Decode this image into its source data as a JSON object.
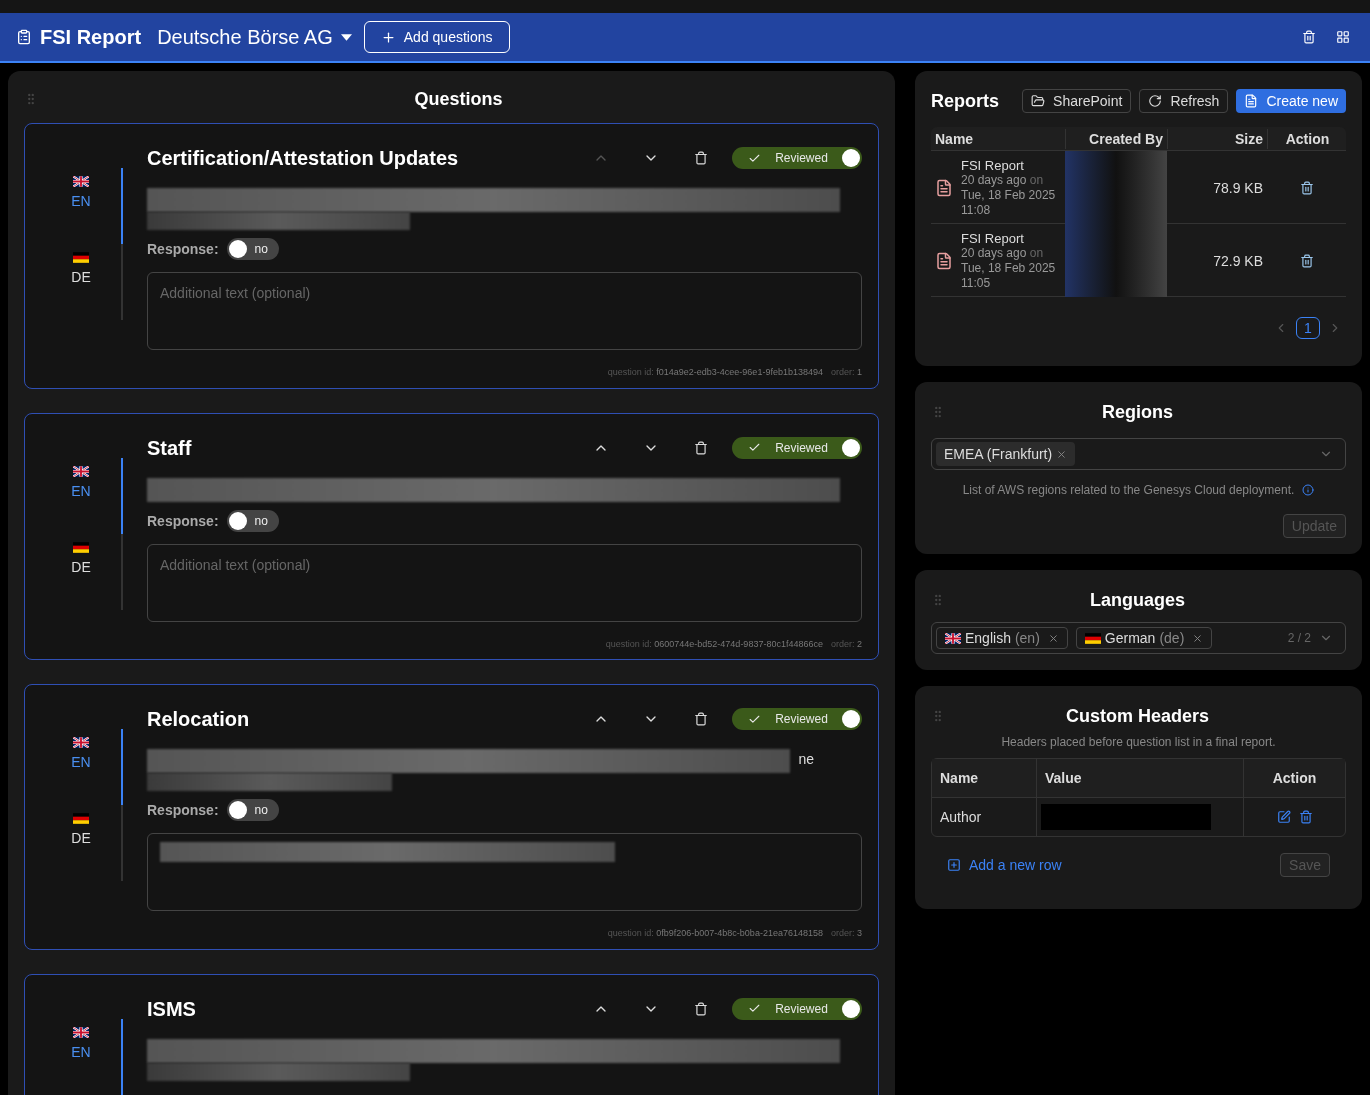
{
  "header": {
    "title": "FSI Report",
    "company": "Deutsche Börse AG",
    "add_button": "Add questions"
  },
  "questions_panel": {
    "title": "Questions",
    "items": [
      {
        "title": "Certification/Attestation Updates",
        "up_disabled": true,
        "languages": [
          {
            "code": "EN",
            "selected": true
          },
          {
            "code": "DE",
            "selected": false
          }
        ],
        "reviewed": {
          "label": "Reviewed",
          "on": true
        },
        "response": {
          "label": "Response:",
          "value": "no",
          "on": false
        },
        "textarea": {
          "placeholder": "Additional text (optional)",
          "redacted": false
        },
        "footer": {
          "id_label": "question id:",
          "id": "f014a9e2-edb3-4cee-96e1-9feb1b138494",
          "order_label": "order:",
          "order": "1"
        }
      },
      {
        "title": "Staff",
        "up_disabled": false,
        "languages": [
          {
            "code": "EN",
            "selected": true
          },
          {
            "code": "DE",
            "selected": false
          }
        ],
        "reviewed": {
          "label": "Reviewed",
          "on": true
        },
        "response": {
          "label": "Response:",
          "value": "no",
          "on": false
        },
        "textarea": {
          "placeholder": "Additional text (optional)",
          "redacted": false
        },
        "footer": {
          "id_label": "question id:",
          "id": "0600744e-bd52-474d-9837-80c1f44866ce",
          "order_label": "order:",
          "order": "2"
        }
      },
      {
        "title": "Relocation",
        "up_disabled": false,
        "fragment": "ne",
        "languages": [
          {
            "code": "EN",
            "selected": true
          },
          {
            "code": "DE",
            "selected": false
          }
        ],
        "reviewed": {
          "label": "Reviewed",
          "on": true
        },
        "response": {
          "label": "Response:",
          "value": "no",
          "on": false
        },
        "textarea": {
          "redacted": true
        },
        "footer": {
          "id_label": "question id:",
          "id": "0fb9f206-b007-4b8c-b0ba-21ea76148158",
          "order_label": "order:",
          "order": "3"
        }
      },
      {
        "title": "ISMS",
        "up_disabled": false,
        "languages": [
          {
            "code": "EN",
            "selected": true
          }
        ],
        "reviewed": {
          "label": "Reviewed",
          "on": true
        }
      }
    ]
  },
  "reports": {
    "title": "Reports",
    "buttons": [
      {
        "kind": "sharepoint",
        "label": "SharePoint"
      },
      {
        "kind": "refresh",
        "label": "Refresh"
      },
      {
        "kind": "create",
        "label": "Create new"
      }
    ],
    "columns": [
      "Name",
      "Created By",
      "Size",
      "Action"
    ],
    "rows": [
      {
        "name": "FSI Report",
        "ago": "20 days ago",
        "on": "on",
        "date": "Tue, 18 Feb 2025",
        "time": "11:08",
        "size": "78.9 KB"
      },
      {
        "name": "FSI Report",
        "ago": "20 days ago",
        "on": "on",
        "date": "Tue, 18 Feb 2025",
        "time": "11:05",
        "size": "72.9 KB"
      }
    ],
    "pages": [
      {
        "label": "1",
        "selected": true
      }
    ]
  },
  "regions": {
    "title": "Regions",
    "tags": [
      "EMEA (Frankfurt)"
    ],
    "hint": "List of AWS regions related to the Genesys Cloud deployment.",
    "button": "Update"
  },
  "languages": {
    "title": "Languages",
    "tags": [
      {
        "name": "English",
        "code": "(en)"
      },
      {
        "name": "German",
        "code": "(de)"
      }
    ],
    "count": "2 / 2"
  },
  "custom_headers": {
    "title": "Custom Headers",
    "subtitle": "Headers placed before question list in a final report.",
    "columns": [
      "Name",
      "Value",
      "Action"
    ],
    "rows": [
      {
        "name": "Author"
      }
    ],
    "add_link": "Add a new row",
    "save": "Save"
  }
}
